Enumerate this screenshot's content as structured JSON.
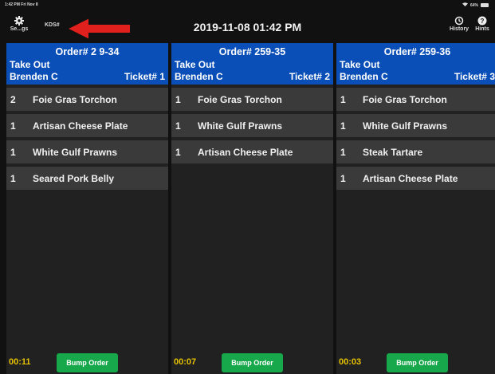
{
  "statusbar": {
    "time": "1:42 PM  Fri Nov 8",
    "battery": "64%"
  },
  "header": {
    "settings_label": "Se...gs",
    "kds_label": "KDS#",
    "datetime": "2019-11-08 01:42 PM",
    "history_label": "History",
    "hints_label": "Hints"
  },
  "colors": {
    "order_header": "#0a4fb8",
    "item_row": "#3a3a3a",
    "column_bg": "#212121",
    "timer": "#e6c200",
    "bump_button": "#16a84a",
    "annotation_arrow": "#e0201c"
  },
  "orders": [
    {
      "order_number": "Order# 2 9-34",
      "type": "Take Out",
      "server": "Brenden C",
      "ticket": "Ticket# 1",
      "items": [
        {
          "qty": "2",
          "name": "Foie Gras Torchon"
        },
        {
          "qty": "1",
          "name": "Artisan Cheese Plate"
        },
        {
          "qty": "1",
          "name": "White Gulf Prawns"
        },
        {
          "qty": "1",
          "name": "Seared Pork Belly"
        }
      ],
      "timer": "00:11",
      "bump_label": "Bump Order"
    },
    {
      "order_number": "Order# 259-35",
      "type": "Take Out",
      "server": "Brenden C",
      "ticket": "Ticket# 2",
      "items": [
        {
          "qty": "1",
          "name": "Foie Gras Torchon"
        },
        {
          "qty": "1",
          "name": "White Gulf Prawns"
        },
        {
          "qty": "1",
          "name": "Artisan Cheese Plate"
        }
      ],
      "timer": "00:07",
      "bump_label": "Bump Order"
    },
    {
      "order_number": "Order# 259-36",
      "type": "Take Out",
      "server": "Brenden C",
      "ticket": "Ticket# 3",
      "items": [
        {
          "qty": "1",
          "name": "Foie Gras Torchon"
        },
        {
          "qty": "1",
          "name": "White Gulf Prawns"
        },
        {
          "qty": "1",
          "name": "Steak Tartare"
        },
        {
          "qty": "1",
          "name": "Artisan Cheese Plate"
        }
      ],
      "timer": "00:03",
      "bump_label": "Bump Order"
    }
  ]
}
